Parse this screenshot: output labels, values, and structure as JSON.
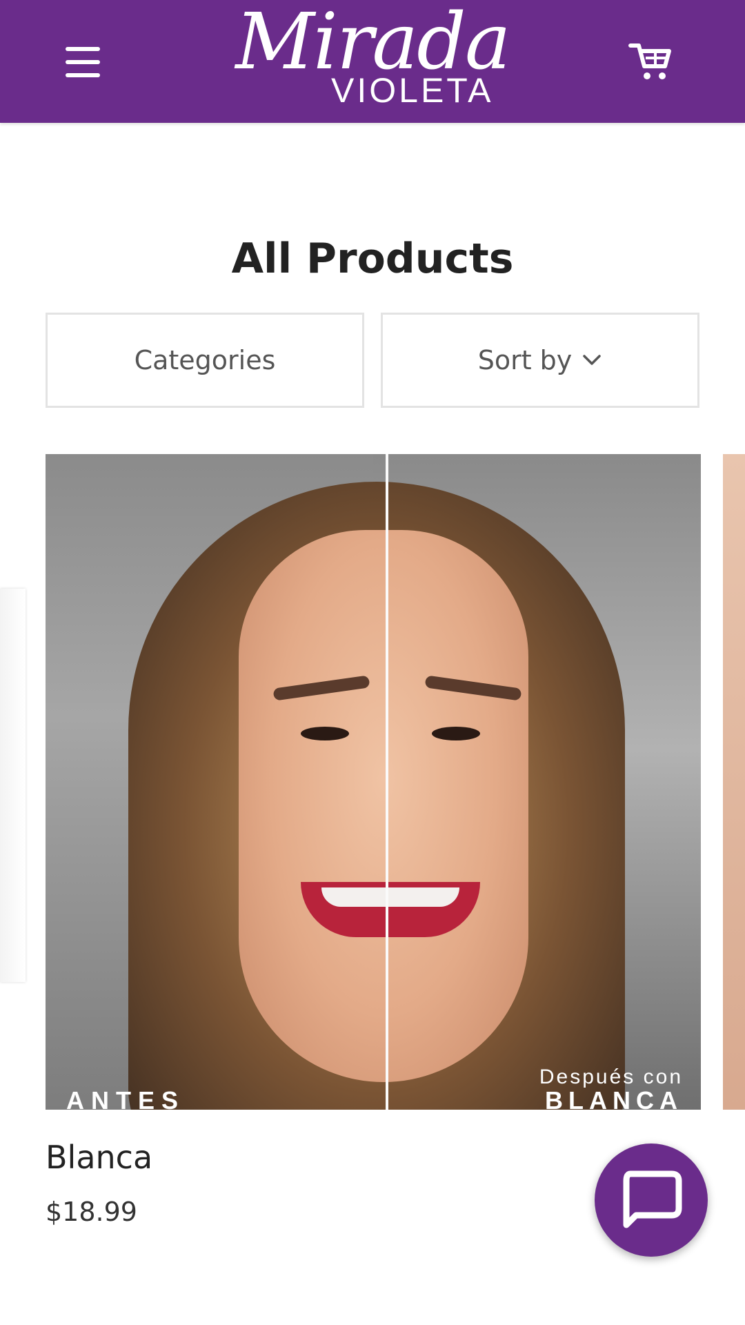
{
  "header": {
    "brand_script": "Mirada",
    "brand_sub": "VIOLETA",
    "menu_icon": "hamburger-menu-icon",
    "cart_icon": "shopping-cart-icon",
    "background_color": "#6a2c8b"
  },
  "page": {
    "title": "All Products"
  },
  "filters": {
    "categories_label": "Categories",
    "sort_label": "Sort by",
    "sort_icon": "chevron-down-icon"
  },
  "products": [
    {
      "name": "Blanca",
      "price": "$18.99",
      "image_caption_left": "ANTES",
      "image_caption_right_top": "Después con",
      "image_caption_right": "BLANCA"
    }
  ],
  "chat": {
    "icon": "chat-bubble-icon"
  }
}
